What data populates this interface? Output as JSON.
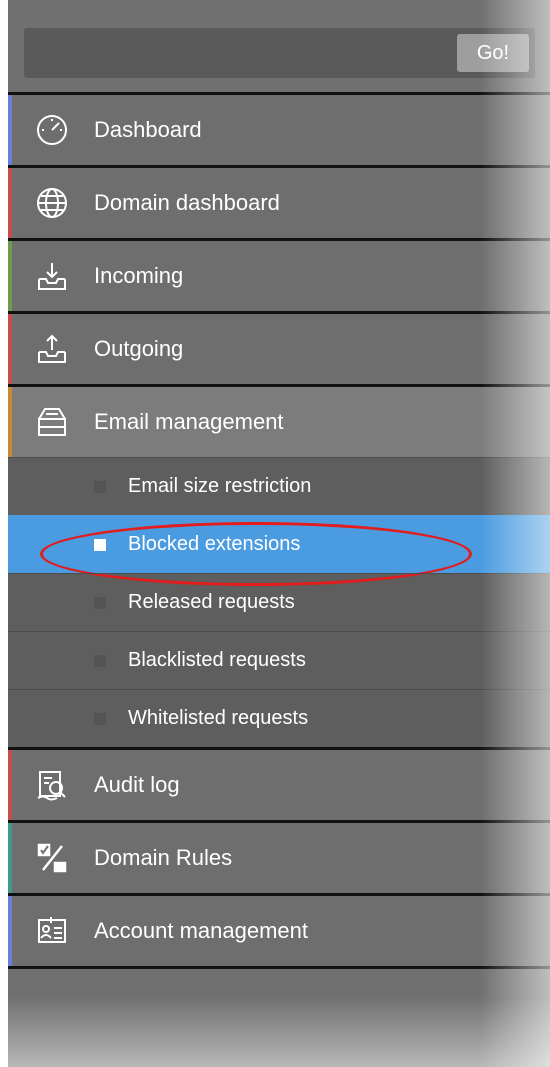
{
  "search": {
    "go_label": "Go!"
  },
  "menu": {
    "items": [
      {
        "label": "Dashboard",
        "icon": "dashboard-gauge-icon",
        "stripe": "#6a7fd8"
      },
      {
        "label": "Domain dashboard",
        "icon": "globe-icon",
        "stripe": "#c94c4c"
      },
      {
        "label": "Incoming",
        "icon": "inbox-download-icon",
        "stripe": "#6f9b4f"
      },
      {
        "label": "Outgoing",
        "icon": "inbox-upload-icon",
        "stripe": "#c94c4c"
      },
      {
        "label": "Email management",
        "icon": "email-tray-icon",
        "stripe": "#c58a3a"
      }
    ],
    "submenu": [
      {
        "label": "Email size restriction"
      },
      {
        "label": "Blocked extensions",
        "active": true
      },
      {
        "label": "Released requests"
      },
      {
        "label": "Blacklisted requests"
      },
      {
        "label": "Whitelisted requests"
      }
    ],
    "items_after": [
      {
        "label": "Audit log",
        "icon": "audit-log-icon",
        "stripe": "#c94c4c"
      },
      {
        "label": "Domain Rules",
        "icon": "domain-rules-icon",
        "stripe": "#3f9a8a"
      },
      {
        "label": "Account management",
        "icon": "account-card-icon",
        "stripe": "#6a7fd8"
      }
    ]
  },
  "colors": {
    "active_item": "#4a9be0",
    "highlight_ring": "#e31c1c"
  }
}
